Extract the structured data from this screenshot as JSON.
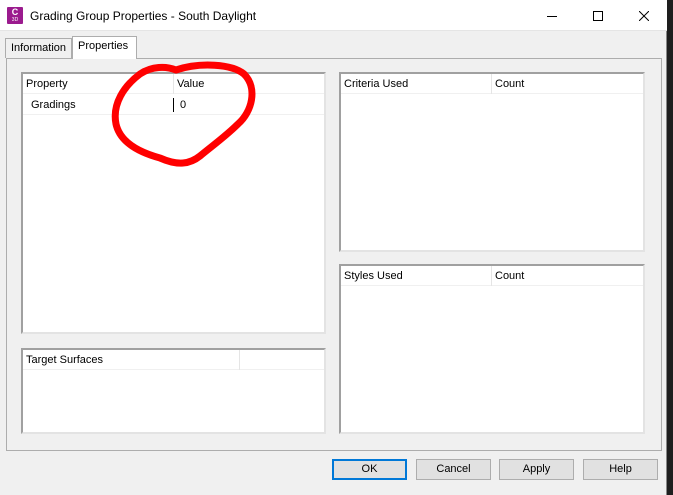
{
  "window": {
    "title": "Grading Group Properties - South Daylight",
    "app_icon_letter": "C",
    "app_icon_version": "3D"
  },
  "tabs": [
    {
      "label": "Information",
      "selected": false
    },
    {
      "label": "Properties",
      "selected": true
    }
  ],
  "property_grid": {
    "columns": [
      "Property",
      "Value"
    ],
    "rows": [
      {
        "property": "Gradings",
        "value": "0"
      }
    ]
  },
  "target_surfaces": {
    "columns": [
      "Target Surfaces",
      ""
    ]
  },
  "criteria_used": {
    "columns": [
      "Criteria Used",
      "Count"
    ]
  },
  "styles_used": {
    "columns": [
      "Styles Used",
      "Count"
    ]
  },
  "buttons": {
    "ok": "OK",
    "cancel": "Cancel",
    "apply": "Apply",
    "help": "Help"
  },
  "colors": {
    "accent": "#0078d7",
    "annotation": "#ff0000",
    "app_icon": "#9b1b8e"
  }
}
